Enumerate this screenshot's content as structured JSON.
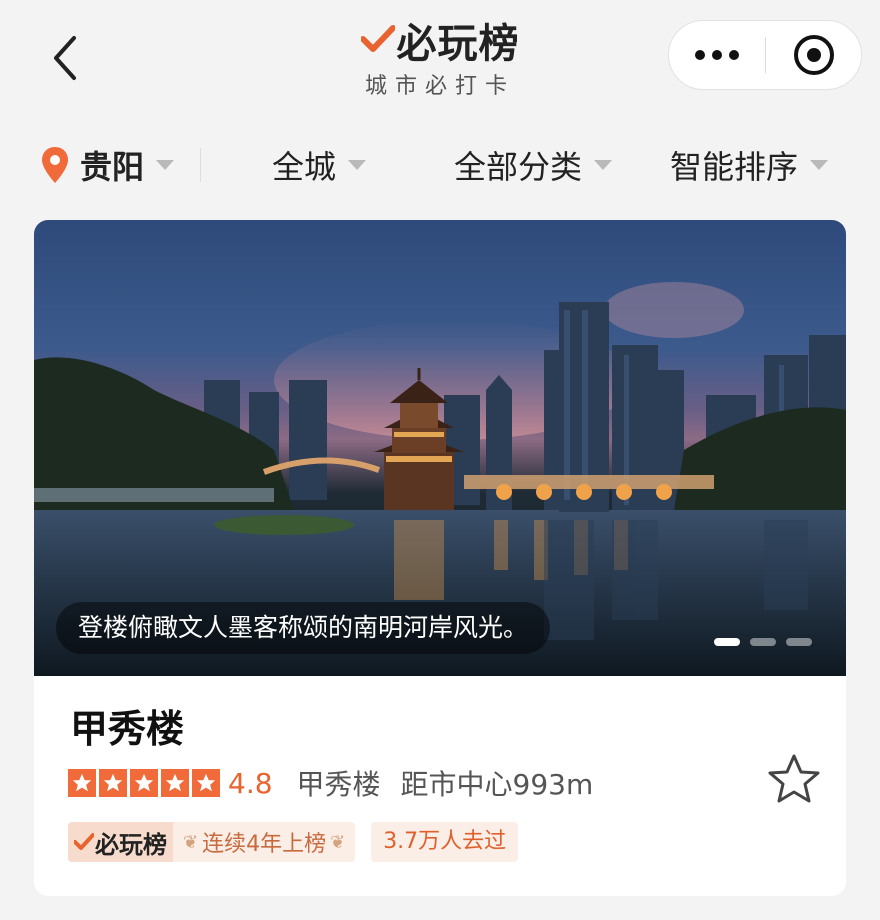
{
  "header": {
    "logo_text": "必玩榜",
    "logo_subtitle": "城市必打卡"
  },
  "filters": {
    "city": "贵阳",
    "area": "全城",
    "category": "全部分类",
    "sort": "智能排序"
  },
  "card": {
    "caption": "登楼俯瞰文人墨客称颂的南明河岸风光。",
    "carousel_count": 3,
    "carousel_active": 1,
    "title": "甲秀楼",
    "rating_stars": 5,
    "rating_score": "4.8",
    "place_name": "甲秀楼",
    "distance": "距市中心993m",
    "badge_logo": "必玩榜",
    "badge_text": "连续4年上榜",
    "visits": "3.7万人去过"
  },
  "colors": {
    "accent": "#e8632f",
    "pin": "#f06a3a",
    "background": "#f3f3f3"
  },
  "icons": [
    "back-icon",
    "more-icon",
    "close-target-icon",
    "location-pin-icon",
    "star-icon",
    "favorite-star-icon"
  ]
}
